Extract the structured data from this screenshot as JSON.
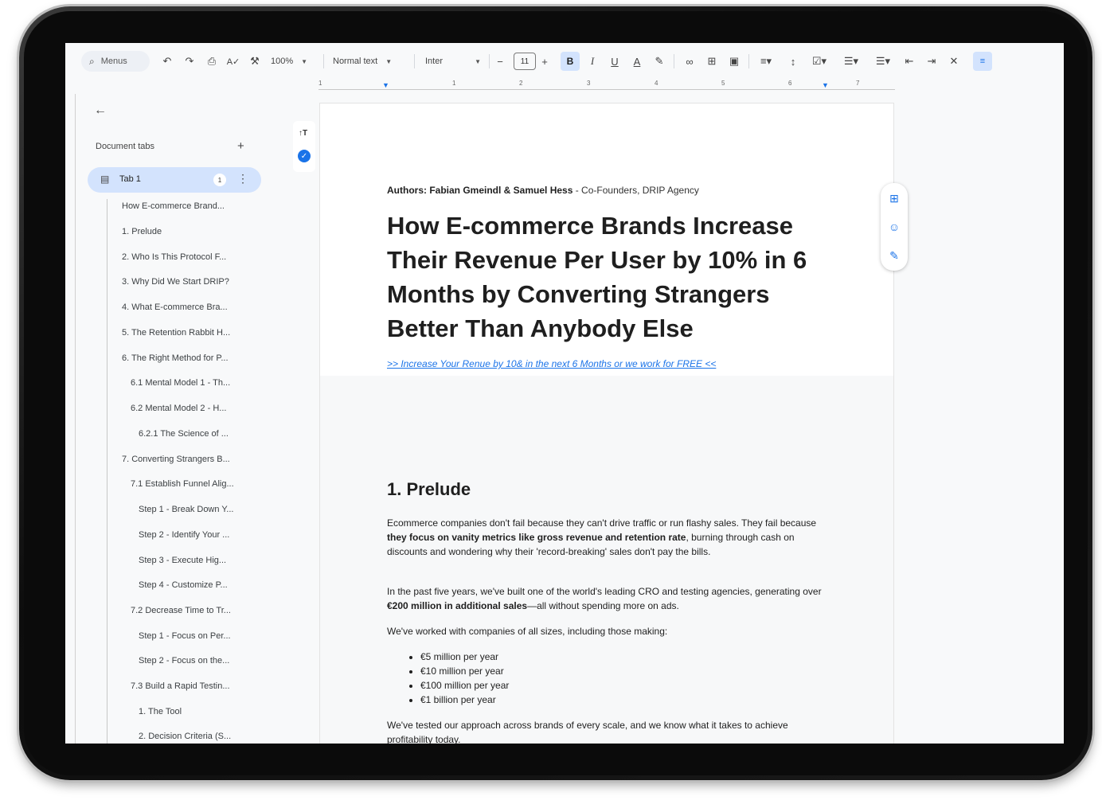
{
  "toolbar": {
    "search_label": "Menus",
    "zoom": "100%",
    "style": "Normal text",
    "font": "Inter",
    "font_size": "11",
    "bold": "B",
    "italic": "I",
    "underline": "U"
  },
  "ruler": {
    "numbers": [
      "1",
      "1",
      "2",
      "3",
      "4",
      "5",
      "6",
      "7"
    ]
  },
  "sidebar": {
    "document_tabs_label": "Document tabs",
    "tab": {
      "label": "Tab 1",
      "badge": "1"
    },
    "outline": [
      "How E-commerce Brand...",
      "1. Prelude",
      "2. Who Is This Protocol F...",
      "3. Why Did We Start DRIP?",
      "4. What E-commerce Bra...",
      "5. The Retention Rabbit H...",
      "6. The Right Method for P...",
      "6.1 Mental Model 1 - Th...",
      "6.2 Mental Model 2 - H...",
      "6.2.1 The Science of ...",
      "7. Converting Strangers B...",
      "7.1 Establish Funnel Alig...",
      "Step 1 - Break Down Y...",
      "Step 2 - Identify Your ...",
      "Step 3 - Execute Hig...",
      "Step 4 - Customize P...",
      "7.2 Decrease Time to Tr...",
      "Step 1 - Focus on Per...",
      "Step 2 - Focus on the...",
      "7.3 Build a Rapid Testin...",
      "1. The Tool",
      "2. Decision Criteria (S..."
    ]
  },
  "document": {
    "authors_bold": "Authors: Fabian Gmeindl & Samuel Hess",
    "authors_rest": " - Co-Founders, DRIP Agency",
    "title": "How E-commerce Brands Increase Their Revenue Per User by 10% in 6 Months by Converting Strangers Better Than Anybody Else",
    "link": ">> Increase Your Renue by 10& in the next 6 Months or we work for FREE <<",
    "heading": "1. Prelude",
    "p1": {
      "a": "Ecommerce companies don't fail because they can't drive traffic or run flashy sales. They fail because ",
      "b": "they focus on vanity metrics like gross revenue and retention rate",
      "c": ", burning through cash on discounts and wondering why their 'record-breaking' sales don't pay the bills."
    },
    "p2": {
      "a": "In the past five years, we've built one of the world's leading CRO and testing agencies, generating over ",
      "b": "€200 million in additional sales",
      "c": "—all without spending more on ads."
    },
    "p3": "We've worked with companies of all sizes, including those making:",
    "bullets": [
      "€5 million per year",
      "€10 million per year",
      "€100 million per year",
      "€1 billion per year"
    ],
    "p4": "We've tested our approach across brands of every scale, and we know what it takes to achieve profitability today."
  }
}
